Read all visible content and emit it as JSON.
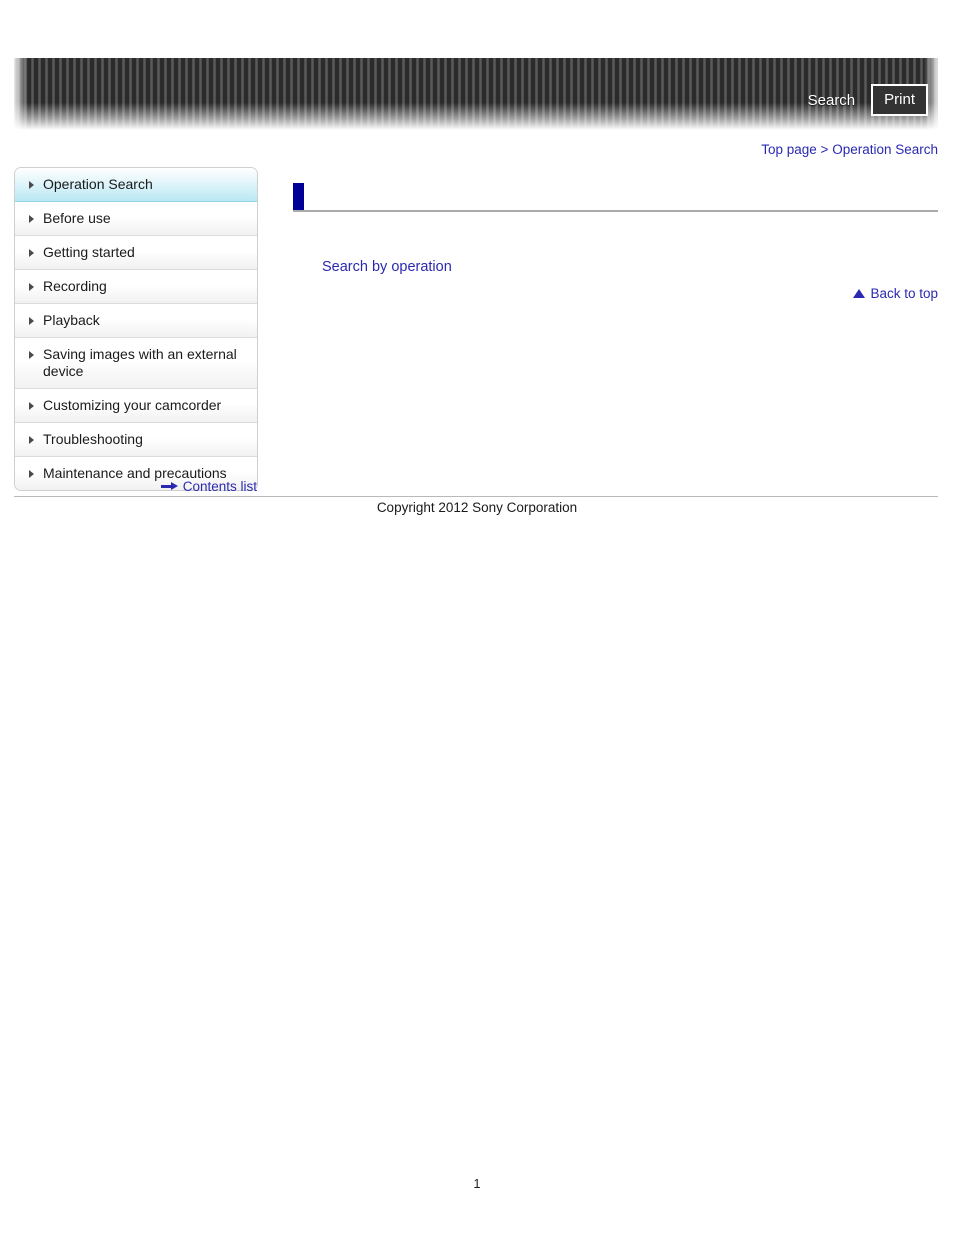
{
  "header": {
    "search_label": "Search",
    "print_label": "Print"
  },
  "breadcrumb": {
    "top_page": "Top page",
    "separator": ">",
    "current": "Operation Search",
    "full": "Top page > Operation Search"
  },
  "sidebar": {
    "items": [
      {
        "label": "Operation Search",
        "active": true
      },
      {
        "label": "Before use",
        "active": false
      },
      {
        "label": "Getting started",
        "active": false
      },
      {
        "label": "Recording",
        "active": false
      },
      {
        "label": "Playback",
        "active": false
      },
      {
        "label": "Saving images with an external device",
        "active": false
      },
      {
        "label": "Customizing your camcorder",
        "active": false
      },
      {
        "label": "Troubleshooting",
        "active": false
      },
      {
        "label": "Maintenance and precautions",
        "active": false
      }
    ],
    "contents_list_label": "Contents list"
  },
  "main": {
    "heading": "",
    "operation_link": "Search by operation",
    "back_to_top_label": "Back to top"
  },
  "footer": {
    "copyright": "Copyright 2012 Sony Corporation",
    "page_number": "1"
  },
  "colors": {
    "link_blue": "#2a2ab0",
    "heading_marker_navy": "#000096",
    "active_nav_cyan": "#b9e8f3",
    "header_dark": "#3a3a3a"
  }
}
